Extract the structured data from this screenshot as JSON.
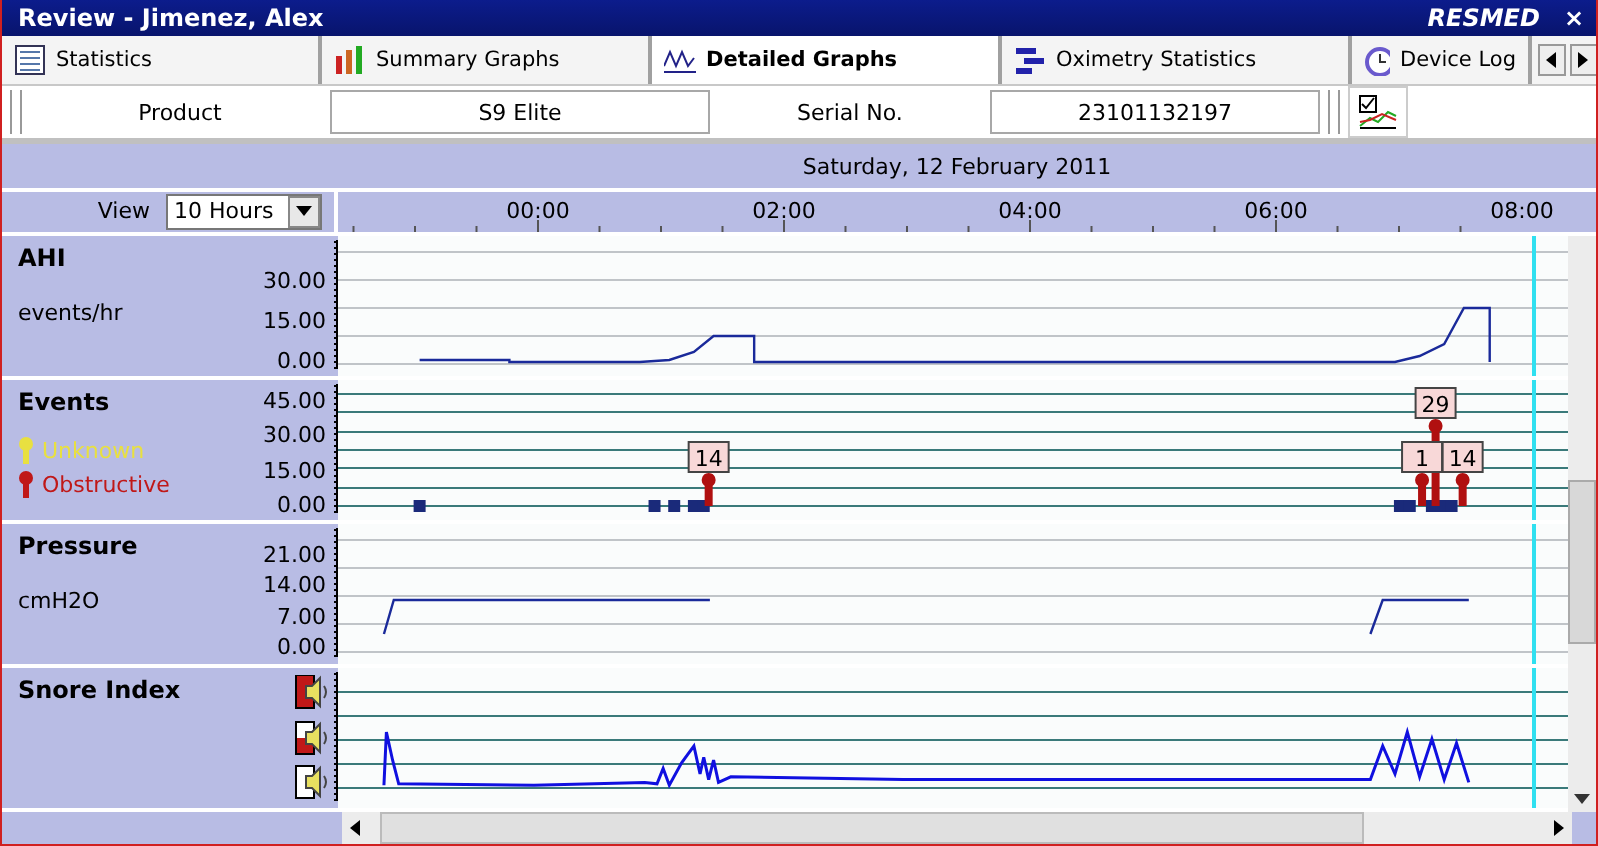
{
  "window": {
    "title": "Review - Jimenez, Alex",
    "logo": "RESMED",
    "close": "×"
  },
  "tabs": [
    {
      "label": "Statistics",
      "selected": false
    },
    {
      "label": "Summary Graphs",
      "selected": false
    },
    {
      "label": "Detailed Graphs",
      "selected": true
    },
    {
      "label": "Oximetry Statistics",
      "selected": false
    },
    {
      "label": "Device Log",
      "selected": false
    }
  ],
  "info": {
    "product_label": "Product",
    "product": "S9 Elite",
    "serial_label": "Serial No.",
    "serial": "23101132197"
  },
  "date_header": "Saturday, 12 February 2011",
  "view": {
    "label": "View",
    "value": "10 Hours"
  },
  "time_labels": [
    "00:00",
    "02:00",
    "04:00",
    "06:00",
    "08:00"
  ],
  "panels": [
    {
      "kind": "line",
      "title": "AHI",
      "unit": "events/hr",
      "y_labels": [
        "30.00",
        "15.00",
        "0.00"
      ]
    },
    {
      "kind": "events",
      "title": "Events",
      "legend": [
        {
          "label": "Unknown",
          "color": "#e8e040"
        },
        {
          "label": "Obstructive",
          "color": "#c01818"
        }
      ],
      "y_labels": [
        "45.00",
        "30.00",
        "15.00",
        "0.00"
      ],
      "event_counts": [
        "29",
        "14",
        "1",
        "14"
      ]
    },
    {
      "kind": "line",
      "title": "Pressure",
      "unit": "cmH2O",
      "y_labels": [
        "21.00",
        "14.00",
        "7.00",
        "0.00"
      ]
    },
    {
      "kind": "snore",
      "title": "Snore Index"
    }
  ]
}
